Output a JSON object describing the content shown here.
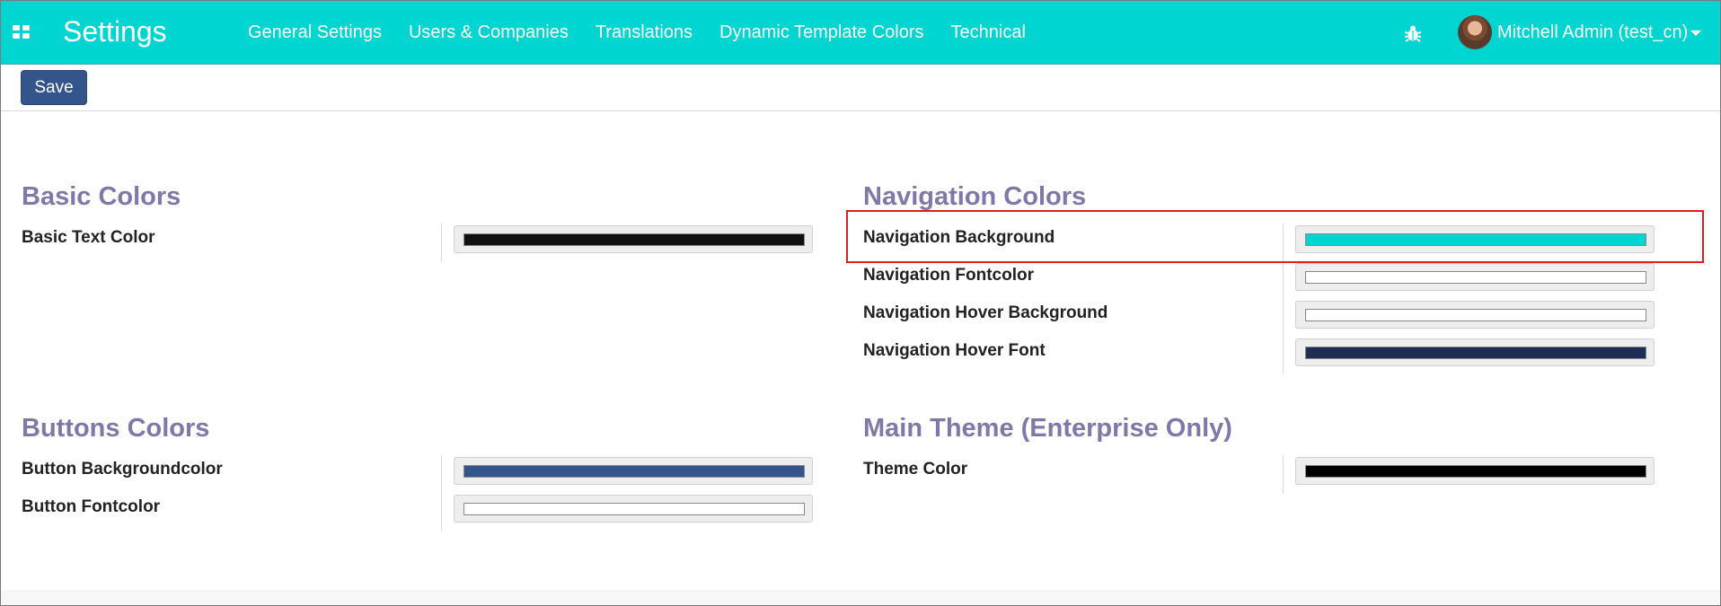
{
  "navbar": {
    "app_title": "Settings",
    "menu": [
      {
        "label": "General Settings"
      },
      {
        "label": "Users & Companies"
      },
      {
        "label": "Translations"
      },
      {
        "label": "Dynamic Template Colors"
      },
      {
        "label": "Technical"
      }
    ],
    "user_name": "Mitchell Admin (test_cn)",
    "background_color": "#00d5d1",
    "icons": [
      "apps-grid-icon",
      "bug-icon",
      "chevron-down-icon"
    ]
  },
  "control_panel": {
    "save_label": "Save",
    "save_color": "#34558b"
  },
  "sections": {
    "basic": {
      "title": "Basic Colors",
      "fields": [
        {
          "label": "Basic Text Color",
          "color": "#111111"
        }
      ]
    },
    "navigation": {
      "title": "Navigation Colors",
      "fields": [
        {
          "label": "Navigation Background",
          "color": "#00d5d1"
        },
        {
          "label": "Navigation Fontcolor",
          "color": "#ffffff"
        },
        {
          "label": "Navigation Hover Background",
          "color": "#ffffff"
        },
        {
          "label": "Navigation Hover Font",
          "color": "#1f2d54"
        }
      ]
    },
    "buttons": {
      "title": "Buttons Colors",
      "fields": [
        {
          "label": "Button Backgroundcolor",
          "color": "#34558b"
        },
        {
          "label": "Button Fontcolor",
          "color": "#ffffff"
        }
      ]
    },
    "theme": {
      "title": "Main Theme (Enterprise Only)",
      "fields": [
        {
          "label": "Theme Color",
          "color": "#000000"
        }
      ]
    }
  },
  "highlight_color": "#e02020"
}
